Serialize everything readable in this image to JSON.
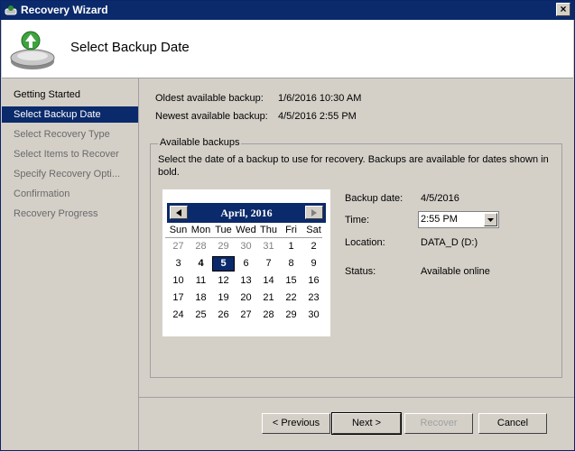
{
  "window": {
    "title": "Recovery Wizard",
    "close_label": "×"
  },
  "header": {
    "title": "Select Backup Date"
  },
  "sidebar": {
    "items": [
      {
        "label": "Getting Started",
        "state": "done"
      },
      {
        "label": "Select Backup Date",
        "state": "active"
      },
      {
        "label": "Select Recovery Type",
        "state": "pending"
      },
      {
        "label": "Select Items to Recover",
        "state": "pending"
      },
      {
        "label": "Specify Recovery Opti...",
        "state": "pending"
      },
      {
        "label": "Confirmation",
        "state": "pending"
      },
      {
        "label": "Recovery Progress",
        "state": "pending"
      }
    ]
  },
  "info": {
    "oldest_label": "Oldest available backup:",
    "oldest_value": "1/6/2016 10:30 AM",
    "newest_label": "Newest available backup:",
    "newest_value": "4/5/2016 2:55 PM"
  },
  "backups": {
    "group_title": "Available backups",
    "description": "Select the date of a backup to use for recovery. Backups are available for dates shown in bold."
  },
  "calendar": {
    "month_label": "April, 2016",
    "days_of_week": [
      "Sun",
      "Mon",
      "Tue",
      "Wed",
      "Thu",
      "Fri",
      "Sat"
    ],
    "weeks": [
      [
        {
          "d": "27",
          "o": true
        },
        {
          "d": "28",
          "o": true
        },
        {
          "d": "29",
          "o": true
        },
        {
          "d": "30",
          "o": true
        },
        {
          "d": "31",
          "o": true
        },
        {
          "d": "1"
        },
        {
          "d": "2"
        }
      ],
      [
        {
          "d": "3"
        },
        {
          "d": "4",
          "b": true
        },
        {
          "d": "5",
          "s": true
        },
        {
          "d": "6"
        },
        {
          "d": "7"
        },
        {
          "d": "8"
        },
        {
          "d": "9"
        }
      ],
      [
        {
          "d": "10"
        },
        {
          "d": "11"
        },
        {
          "d": "12"
        },
        {
          "d": "13"
        },
        {
          "d": "14"
        },
        {
          "d": "15"
        },
        {
          "d": "16"
        }
      ],
      [
        {
          "d": "17"
        },
        {
          "d": "18"
        },
        {
          "d": "19"
        },
        {
          "d": "20"
        },
        {
          "d": "21"
        },
        {
          "d": "22"
        },
        {
          "d": "23"
        }
      ],
      [
        {
          "d": "24"
        },
        {
          "d": "25"
        },
        {
          "d": "26"
        },
        {
          "d": "27"
        },
        {
          "d": "28"
        },
        {
          "d": "29"
        },
        {
          "d": "30"
        }
      ]
    ]
  },
  "details": {
    "backup_date_label": "Backup date:",
    "backup_date_value": "4/5/2016",
    "time_label": "Time:",
    "time_value": "2:55 PM",
    "location_label": "Location:",
    "location_value": "DATA_D (D:)",
    "status_label": "Status:",
    "status_value": "Available online"
  },
  "buttons": {
    "previous": "< Previous",
    "next": "Next >",
    "recover": "Recover",
    "cancel": "Cancel"
  },
  "colors": {
    "accent": "#0b2a6b",
    "window_bg": "#d4d0c8"
  },
  "icons": [
    "wizard-icon",
    "backup-disk-icon",
    "close-icon",
    "prev-month-icon",
    "next-month-icon",
    "dropdown-arrow-icon"
  ]
}
